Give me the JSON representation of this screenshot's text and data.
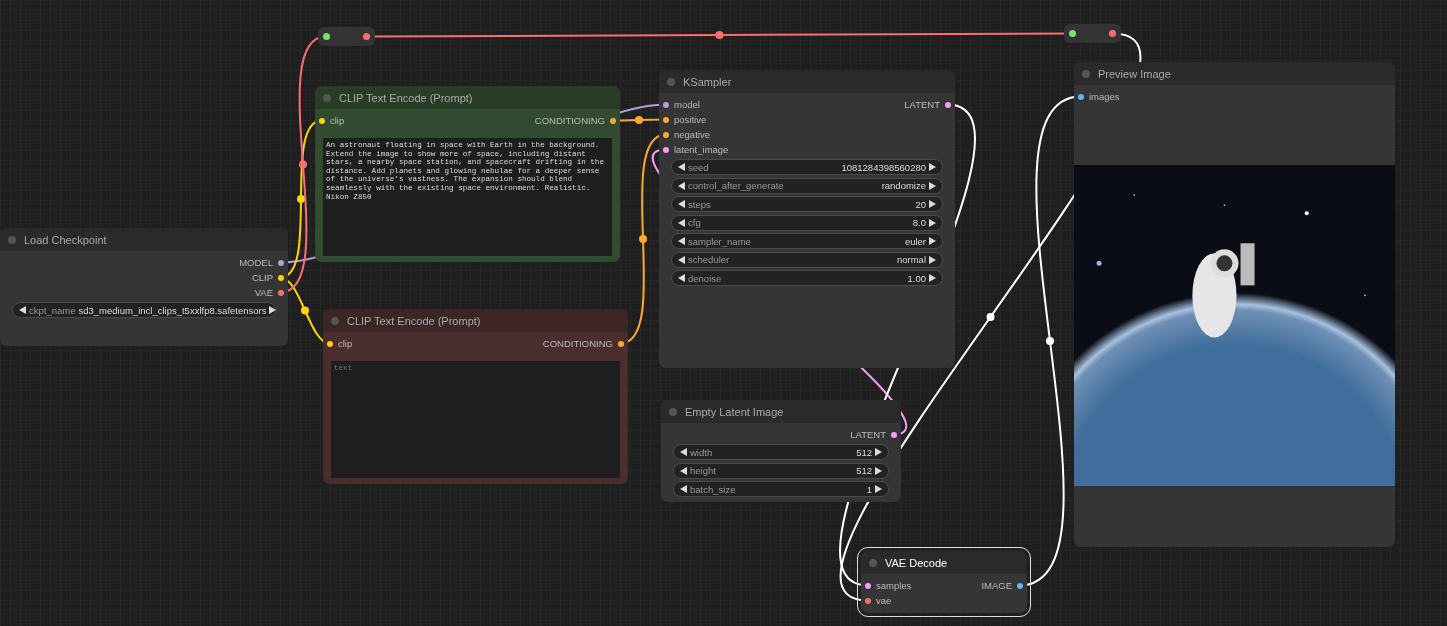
{
  "nodes": [
    {
      "title": "Load Checkpoint",
      "kind": "widgets",
      "color": "#353535",
      "selected": false,
      "outputs": [
        {
          "label": "MODEL",
          "color": "#b39ddb"
        },
        {
          "label": "CLIP",
          "color": "#ffd500"
        },
        {
          "label": "VAE",
          "color": "#ff6e6e"
        }
      ],
      "widgets": [
        {
          "label": "ckpt_name",
          "value": "sd3_medium_incl_clips_t5xxlfp8.safetensors"
        }
      ]
    },
    {
      "title": "CLIP Text Encode (Prompt)",
      "kind": "prompt",
      "color": "#324b30",
      "selected": false,
      "inputs": [
        {
          "label": "clip",
          "color": "#ffd500"
        }
      ],
      "outputs": [
        {
          "label": "CONDITIONING",
          "color": "#ffa931"
        }
      ],
      "text": "An astronaut floating in space with Earth in the background. Extend the image to show more of space, including distant stars, a nearby space station, and spacecraft drifting in the distance. Add planets and glowing nebulae for a deeper sense of the universe’s vastness. The expansion should blend seamlessly with the existing space environment. Realistic. Nikon Z850"
    },
    {
      "title": "CLIP Text Encode (Prompt)",
      "kind": "prompt",
      "color": "#4a2e2e",
      "selected": false,
      "inputs": [
        {
          "label": "clip",
          "color": "#ffd500"
        }
      ],
      "outputs": [
        {
          "label": "CONDITIONING",
          "color": "#ffa931"
        }
      ],
      "placeholder": "text"
    },
    {
      "title": "KSampler",
      "kind": "widgets",
      "color": "#353535",
      "selected": false,
      "inputs": [
        {
          "label": "model",
          "color": "#b39ddb"
        },
        {
          "label": "positive",
          "color": "#ffa931"
        },
        {
          "label": "negative",
          "color": "#ffa931"
        },
        {
          "label": "latent_image",
          "color": "#ff9cf9"
        }
      ],
      "outputs": [
        {
          "label": "LATENT",
          "color": "#ff9cf9"
        }
      ],
      "widgets": [
        {
          "label": "seed",
          "value": "1081284398560280"
        },
        {
          "label": "control_after_generate",
          "value": "randomize"
        },
        {
          "label": "steps",
          "value": "20"
        },
        {
          "label": "cfg",
          "value": "8.0"
        },
        {
          "label": "sampler_name",
          "value": "euler"
        },
        {
          "label": "scheduler",
          "value": "normal"
        },
        {
          "label": "denoise",
          "value": "1.00"
        }
      ]
    },
    {
      "title": "Empty Latent Image",
      "kind": "widgets",
      "color": "#353535",
      "selected": false,
      "outputs": [
        {
          "label": "LATENT",
          "color": "#ff9cf9"
        }
      ],
      "widgets": [
        {
          "label": "width",
          "value": "512"
        },
        {
          "label": "height",
          "value": "512"
        },
        {
          "label": "batch_size",
          "value": "1"
        }
      ]
    },
    {
      "title": "VAE Decode",
      "kind": "widgets",
      "color": "#353535",
      "selected": true,
      "inputs": [
        {
          "label": "samples",
          "color": "#ff9cf9"
        },
        {
          "label": "vae",
          "color": "#ff6e6e"
        }
      ],
      "outputs": [
        {
          "label": "IMAGE",
          "color": "#64b5f6"
        }
      ]
    },
    {
      "title": "Preview Image",
      "kind": "preview",
      "color": "#353535",
      "selected": false,
      "inputs": [
        {
          "label": "images",
          "color": "#64b5f6"
        }
      ]
    }
  ]
}
